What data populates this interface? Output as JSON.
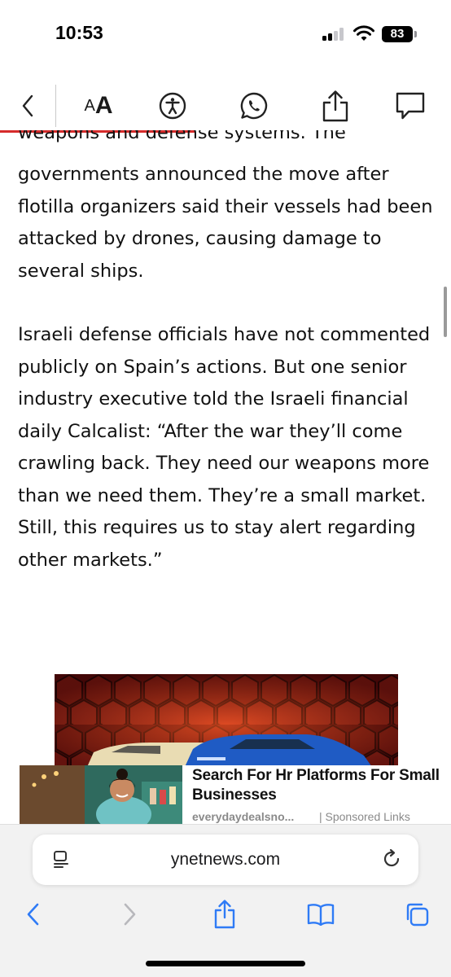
{
  "status_bar": {
    "time": "10:53",
    "battery": "83",
    "icons": [
      "cellular-signal-icon",
      "wifi-icon",
      "battery-icon"
    ]
  },
  "article_toolbar": {
    "back_icon": "chevron-left-icon",
    "font_size_small": "A",
    "font_size_big": "A",
    "icons": [
      "accessibility-icon",
      "whatsapp-icon",
      "share-icon",
      "comment-icon"
    ],
    "accent_color": "#d62b2b"
  },
  "article": {
    "clipped_line": "weapons and defense systems. The",
    "paragraphs": [
      "governments announced the move after flotilla organizers said their vessels had been attacked by drones, causing damage to several ships.",
      "Israeli defense officials have not commented publicly on Spain’s actions. But one senior industry executive told the Israeli financial daily Calcalist: “After the war they’ll come crawling back. They need our weapons more than we need them. They’re a small market. Still, this requires us to stay alert regarding other markets.”"
    ]
  },
  "sponsored": {
    "title": "Search For Hr Platforms For Small Businesses",
    "source": "everydaydealsno...",
    "label": "| Sponsored Links"
  },
  "browser": {
    "url": "ynetnews.com",
    "icons": [
      "reader-mode-icon",
      "reload-icon",
      "back-arrow-icon",
      "forward-arrow-icon",
      "share-icon",
      "bookmarks-icon",
      "tabs-icon"
    ],
    "tint": "#2f7bf6"
  }
}
